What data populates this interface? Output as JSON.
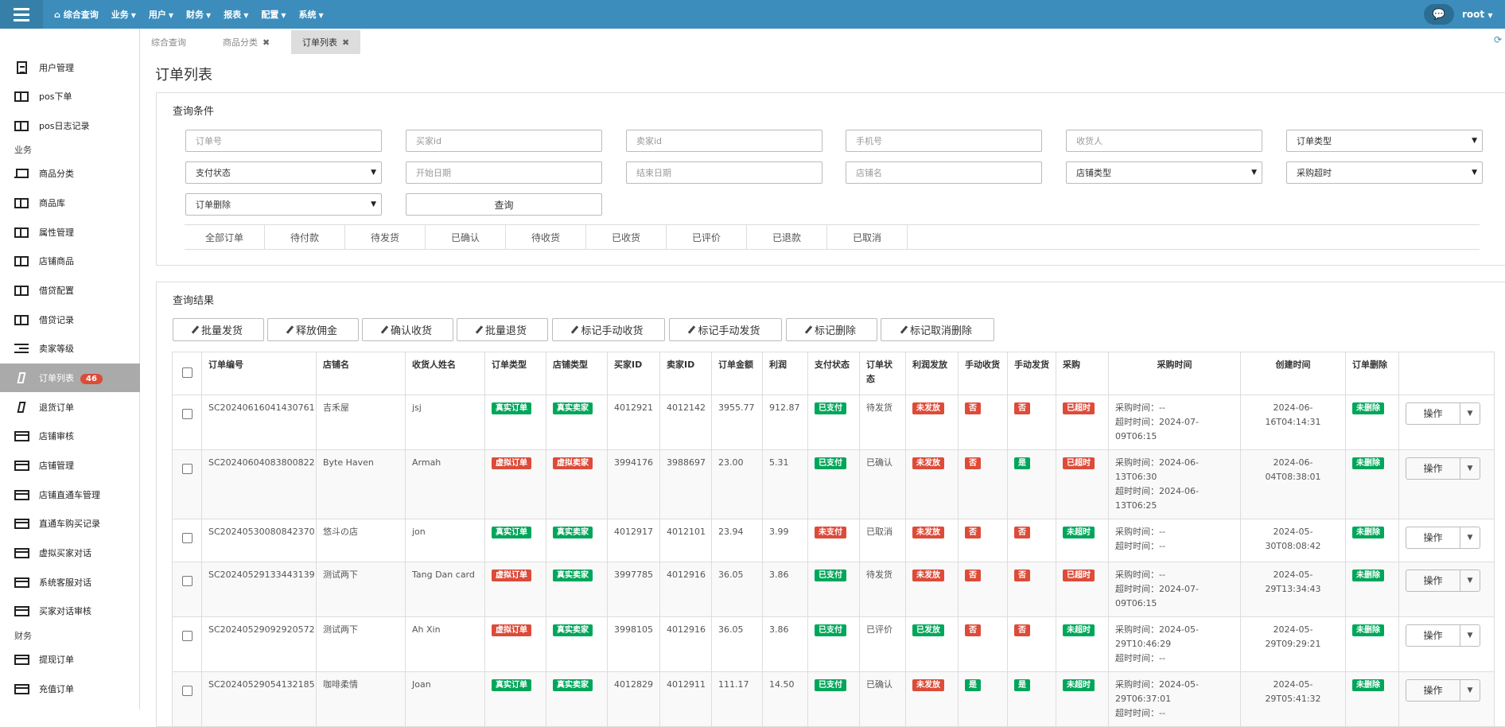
{
  "topnav": {
    "home": "综合查询",
    "items": [
      "业务",
      "用户",
      "财务",
      "报表",
      "配置",
      "系统"
    ],
    "user": "root"
  },
  "sidebar": {
    "items": [
      {
        "label": "用户管理",
        "icon": "document-icon"
      },
      {
        "label": "pos下单",
        "icon": "table-icon"
      },
      {
        "label": "pos日志记录",
        "icon": "table-icon"
      },
      {
        "label": "商品分类",
        "icon": "laptop-icon"
      },
      {
        "label": "商品库",
        "icon": "table-icon"
      },
      {
        "label": "属性管理",
        "icon": "table-icon"
      },
      {
        "label": "店铺商品",
        "icon": "table-icon"
      },
      {
        "label": "借贷配置",
        "icon": "table-icon"
      },
      {
        "label": "借贷记录",
        "icon": "table-icon"
      },
      {
        "label": "卖家等级",
        "icon": "list-icon"
      },
      {
        "label": "订单列表",
        "icon": "mobile-icon",
        "badge": "46"
      },
      {
        "label": "退货订单",
        "icon": "mobile-icon"
      },
      {
        "label": "店铺审核",
        "icon": "credit-card-icon"
      },
      {
        "label": "店铺管理",
        "icon": "credit-card-icon"
      },
      {
        "label": "店铺直通车管理",
        "icon": "credit-card-icon"
      },
      {
        "label": "直通车购买记录",
        "icon": "credit-card-icon"
      },
      {
        "label": "虚拟买家对话",
        "icon": "credit-card-icon"
      },
      {
        "label": "系统客服对话",
        "icon": "credit-card-icon"
      },
      {
        "label": "买家对话审核",
        "icon": "credit-card-icon"
      },
      {
        "label": "提现订单",
        "icon": "credit-card-icon"
      },
      {
        "label": "充值订单",
        "icon": "credit-card-icon"
      }
    ],
    "headers": [
      "业务",
      "财务"
    ]
  },
  "tabs": [
    {
      "label": "综合查询"
    },
    {
      "label": "商品分类"
    },
    {
      "label": "订单列表"
    }
  ],
  "page_title": "订单列表",
  "query": {
    "title": "查询条件",
    "fields": [
      "订单号",
      "买家id",
      "卖家id",
      "手机号",
      "收货人",
      "订单类型",
      "支付状态",
      "开始日期",
      "结束日期",
      "店铺名",
      "店铺类型",
      "采购超时",
      "订单删除"
    ],
    "search_button": "查询",
    "status_tabs": [
      "全部订单",
      "待付款",
      "待发货",
      "已确认",
      "待收货",
      "已收货",
      "已评价",
      "已退款",
      "已取消"
    ]
  },
  "results": {
    "title": "查询结果",
    "actions": [
      "批量发货",
      "释放佣金",
      "确认收货",
      "批量退货",
      "标记手动收货",
      "标记手动发货",
      "标记删除",
      "标记取消删除"
    ],
    "columns": [
      "订单编号",
      "店铺名",
      "收货人姓名",
      "订单类型",
      "店铺类型",
      "买家ID",
      "卖家ID",
      "订单金额",
      "利润",
      "支付状态",
      "订单状态",
      "利润发放",
      "手动收货",
      "手动发货",
      "采购",
      "采购时间",
      "创建时间",
      "订单删除",
      ""
    ],
    "op_label": "操作",
    "rows": [
      {
        "no": "SC20240616041430761",
        "shop": "吉禾屋",
        "name": "jsj",
        "otype": "真实订单",
        "stype": "真实卖家",
        "buyer": "4012921",
        "seller": "4012142",
        "amount": "3955.77",
        "profit": "912.87",
        "pay": "已支付",
        "status": "待发货",
        "release": "未发放",
        "mrecv": "否",
        "msend": "否",
        "purchase": "已超时",
        "ptime": [
          "采购时间：--",
          "超时时间：2024-07-",
          "09T06:15"
        ],
        "ctime": [
          "2024-06-",
          "16T04:14:31"
        ],
        "del": "未删除"
      },
      {
        "no": "SC20240604083800822",
        "shop": "Byte Haven",
        "name": "Armah",
        "otype": "虚拟订单",
        "stype": "虚拟卖家",
        "buyer": "3994176",
        "seller": "3988697",
        "amount": "23.00",
        "profit": "5.31",
        "pay": "已支付",
        "status": "已确认",
        "release": "未发放",
        "mrecv": "否",
        "msend": "是",
        "purchase": "已超时",
        "ptime": [
          "采购时间：2024-06-",
          "13T06:30",
          "超时时间：2024-06-",
          "13T06:25"
        ],
        "ctime": [
          "2024-06-",
          "04T08:38:01"
        ],
        "del": "未删除"
      },
      {
        "no": "SC20240530080842370",
        "shop": "悠斗の店",
        "name": "jon",
        "otype": "真实订单",
        "stype": "真实卖家",
        "buyer": "4012917",
        "seller": "4012101",
        "amount": "23.94",
        "profit": "3.99",
        "pay": "未支付",
        "status": "已取消",
        "release": "未发放",
        "mrecv": "否",
        "msend": "否",
        "purchase": "未超时",
        "ptime": [
          "采购时间：--",
          "超时时间：--"
        ],
        "ctime": [
          "2024-05-",
          "30T08:08:42"
        ],
        "del": "未删除"
      },
      {
        "no": "SC20240529133443139",
        "shop": "测试两下",
        "name": "Tang Dan card",
        "otype": "虚拟订单",
        "stype": "真实卖家",
        "buyer": "3997785",
        "seller": "4012916",
        "amount": "36.05",
        "profit": "3.86",
        "pay": "已支付",
        "status": "待发货",
        "release": "未发放",
        "mrecv": "否",
        "msend": "否",
        "purchase": "已超时",
        "ptime": [
          "采购时间：--",
          "超时时间：2024-07-",
          "09T06:15"
        ],
        "ctime": [
          "2024-05-",
          "29T13:34:43"
        ],
        "del": "未删除"
      },
      {
        "no": "SC20240529092920572",
        "shop": "测试两下",
        "name": "Ah Xin",
        "otype": "虚拟订单",
        "stype": "真实卖家",
        "buyer": "3998105",
        "seller": "4012916",
        "amount": "36.05",
        "profit": "3.86",
        "pay": "已支付",
        "status": "已评价",
        "release": "已发放",
        "mrecv": "否",
        "msend": "否",
        "purchase": "未超时",
        "ptime": [
          "采购时间：2024-05-",
          "29T10:46:29",
          "超时时间：--"
        ],
        "ctime": [
          "2024-05-",
          "29T09:29:21"
        ],
        "del": "未删除"
      },
      {
        "no": "SC20240529054132185",
        "shop": "咖啡柔情",
        "name": "Joan",
        "otype": "真实订单",
        "stype": "真实卖家",
        "buyer": "4012829",
        "seller": "4012911",
        "amount": "111.17",
        "profit": "14.50",
        "pay": "已支付",
        "status": "已确认",
        "release": "未发放",
        "mrecv": "是",
        "msend": "是",
        "purchase": "未超时",
        "ptime": [
          "采购时间：2024-05-",
          "29T06:37:01",
          "超时时间：--"
        ],
        "ctime": [
          "2024-05-",
          "29T05:41:32"
        ],
        "del": "未删除"
      }
    ]
  }
}
